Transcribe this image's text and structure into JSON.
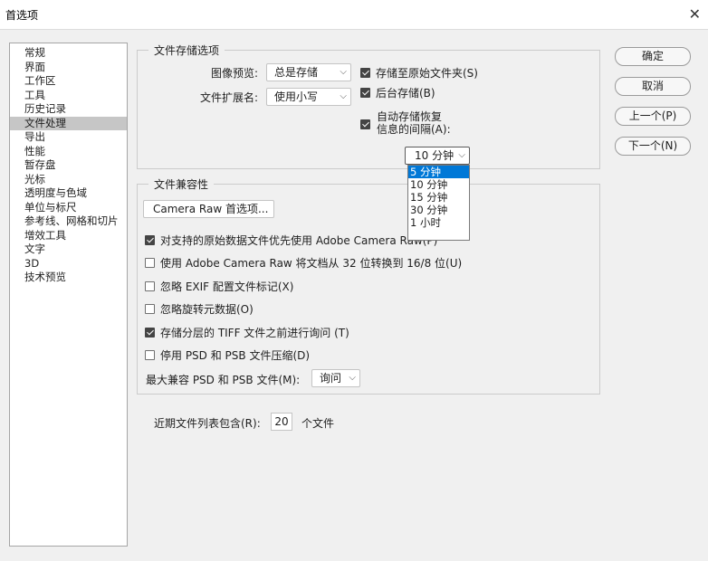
{
  "window": {
    "title": "首选项",
    "close_glyph": "✕"
  },
  "sidebar": {
    "items": [
      {
        "label": "常规"
      },
      {
        "label": "界面"
      },
      {
        "label": "工作区"
      },
      {
        "label": "工具"
      },
      {
        "label": "历史记录"
      },
      {
        "label": "文件处理",
        "selected": true
      },
      {
        "label": "导出"
      },
      {
        "label": "性能"
      },
      {
        "label": "暂存盘"
      },
      {
        "label": "光标"
      },
      {
        "label": "透明度与色域"
      },
      {
        "label": "单位与标尺"
      },
      {
        "label": "参考线、网格和切片"
      },
      {
        "label": "增效工具"
      },
      {
        "label": "文字"
      },
      {
        "label": "3D"
      },
      {
        "label": "技术预览"
      }
    ]
  },
  "file_saving": {
    "legend": "文件存储选项",
    "preview_label": "图像预览:",
    "preview_value": "总是存储",
    "ext_label": "文件扩展名:",
    "ext_value": "使用小写",
    "save_to_original": "存储至原始文件夹(S)",
    "background_save": "后台存储(B)",
    "auto_recover_line1": "自动存储恢复",
    "auto_recover_line2": "信息的间隔(A):",
    "interval_value": "10 分钟",
    "interval_options": [
      "5 分钟",
      "10 分钟",
      "15 分钟",
      "30 分钟",
      "1 小时"
    ]
  },
  "compat": {
    "legend": "文件兼容性",
    "camera_raw_button": "Camera Raw 首选项...",
    "options": [
      {
        "label": "对支持的原始数据文件优先使用 Adobe Camera Raw(P)",
        "checked": true
      },
      {
        "label": "使用 Adobe Camera Raw 将文档从 32 位转换到 16/8 位(U)",
        "checked": false
      },
      {
        "label": "忽略 EXIF 配置文件标记(X)",
        "checked": false
      },
      {
        "label": "忽略旋转元数据(O)",
        "checked": false
      },
      {
        "label": "存储分层的 TIFF 文件之前进行询问 (T)",
        "checked": true
      },
      {
        "label": "停用 PSD 和 PSB 文件压缩(D)",
        "checked": false
      }
    ],
    "max_compat_label": "最大兼容 PSD 和 PSB 文件(M):",
    "max_compat_value": "询问"
  },
  "recent": {
    "label": "近期文件列表包含(R):",
    "value": "20",
    "suffix": "个文件"
  },
  "buttons": {
    "ok": "确定",
    "cancel": "取消",
    "prev": "上一个(P)",
    "next": "下一个(N)"
  },
  "icons": {
    "chevron": "chevron-down-icon",
    "close": "close-icon"
  },
  "colors": {
    "highlight": "#0078d7",
    "selected_item": "#c6c6c6"
  }
}
